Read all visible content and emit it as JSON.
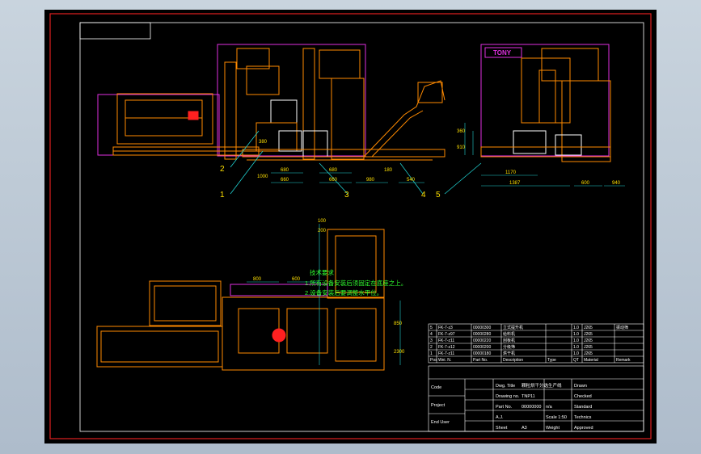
{
  "drawing": {
    "brand": "TONY",
    "balloons": [
      "1",
      "2",
      "3",
      "4",
      "5"
    ],
    "dims_front": [
      "380",
      "1000",
      "660",
      "660",
      "980",
      "540",
      "180",
      "680",
      "680"
    ],
    "dims_side": [
      "360",
      "910",
      "1170",
      "1387",
      "600",
      "940",
      "600"
    ],
    "dims_plan": [
      "100",
      "200",
      "800",
      "600",
      "850",
      "2300"
    ],
    "notes": [
      "技术要求",
      "1.所有设备安装后须固定在底座之上。",
      "2.设备安装后要调整水平位。"
    ]
  },
  "parts_table": {
    "rows": [
      {
        "no": "5",
        "code": "FK-7-z3",
        "part": "00000300",
        "desc": "立式提升机",
        "qty": "1.0",
        "spec": "J265",
        "remark": "振动筛"
      },
      {
        "no": "4",
        "code": "FK-7-z97",
        "part": "00000280",
        "desc": "给料机",
        "qty": "1.0",
        "spec": "J265",
        "remark": ""
      },
      {
        "no": "3",
        "code": "FK-7-z11",
        "part": "00000220",
        "desc": "刮板机",
        "qty": "1.0",
        "spec": "J265",
        "remark": ""
      },
      {
        "no": "2",
        "code": "FK-7-z12",
        "part": "00000200",
        "desc": "分级筛",
        "qty": "1.0",
        "spec": "J265",
        "remark": ""
      },
      {
        "no": "1",
        "code": "FK-7-z11",
        "part": "00000180",
        "desc": "烘干机",
        "qty": "1.0",
        "spec": "J265",
        "remark": ""
      }
    ],
    "header": [
      "Pos",
      "Wei. N.",
      "Part No.",
      "Description",
      "Type",
      "QT",
      "Material",
      "Remark"
    ]
  },
  "title_block": {
    "left_labels": [
      "Code",
      "Project",
      "End User"
    ],
    "rows": [
      {
        "label": "Dwg. Title",
        "value": "颗粒烘干分选生产线",
        "right": "Drawn"
      },
      {
        "label": "Drawing no.",
        "value": "TNP11",
        "right": "Checked"
      },
      {
        "label": "Part No.",
        "value": "00000000",
        "mid": "n/a",
        "right": "Standard"
      },
      {
        "label": "A.J.",
        "value": "",
        "mid": "Scale 1:50",
        "right": "Technics"
      },
      {
        "label": "Sheet",
        "value": "A3",
        "mid": "Weight",
        "right": "Approved"
      }
    ]
  },
  "colors": {
    "orange": "#ff8a00",
    "magenta": "#e030e0",
    "white": "#ffffff",
    "cyan": "#20d0d0",
    "green": "#30ff30",
    "yellow": "#ffe000",
    "red": "#ff2020"
  }
}
